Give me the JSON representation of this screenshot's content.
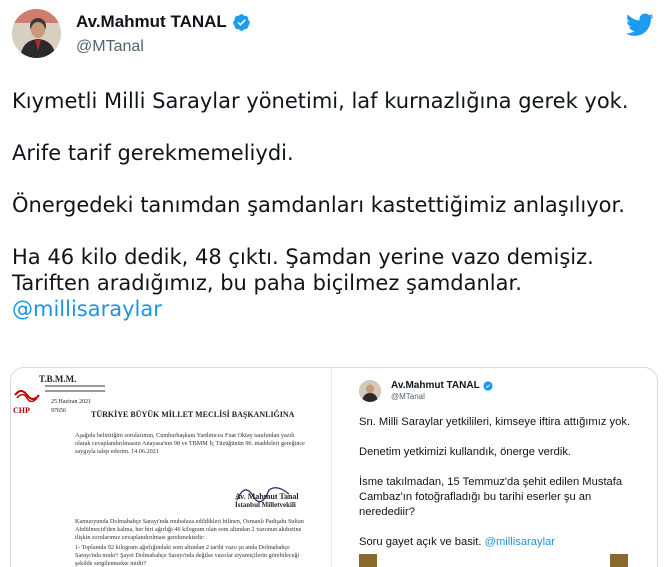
{
  "tweet": {
    "author_name": "Av.Mahmut TANAL",
    "handle": "@MTanal",
    "lines": [
      "Kıymetli Milli Saraylar yönetimi, laf kurnazlığına gerek yok.",
      "Arife tarif gerekmemeliydi.",
      "Önergedeki tanımdan şamdanları kastettiğimiz anlaşılıyor.",
      "Ha 46 kilo dedik, 48 çıktı. Şamdan yerine vazo demişiz.",
      "Tariften aradığımız, bu paha biçilmez şamdanlar.",
      "@millisaraylar"
    ],
    "icons": {
      "verified": "verified-badge-icon",
      "bird": "twitter-bird-icon"
    },
    "colors": {
      "accent": "#1d9bf0",
      "link": "#1b95e0",
      "text": "#0f1419",
      "muted": "#536471"
    }
  },
  "document": {
    "tbmm": "T.B.M.M.",
    "chp": "CHP",
    "date": "25 Haziran 2021",
    "number": "97656",
    "heading": "TÜRKİYE BÜYÜK MİLLET MECLİSİ BAŞKANLIĞINA",
    "para1": "Aşağıda belirttiğim sorularımın, Cumhurbaşkanı Yardımcısı Fuat Oktay tarafından yazılı olarak cevaplandırılmasını Anayasa'nın 98 ve TBMM İç Tüzüğünün 96. maddeleri gereğince saygıyla talep ederim. 14.06.2021",
    "signer_name": "Av. Mahmut Tanal",
    "signer_role": "İstanbul Milletvekili",
    "para2": "Kamuoyunda Dolmabahçe Sarayı'nda muhafaza edildikleri bilinen, Osmanlı Padişahı Sultan Abdülmecid'den kalma, her biri ağırlığı 46 kilogram olan som altından 2 vazonun akıbetine ilişkin sorularımız cevaplandırılması gerekmektedir:",
    "item1": "1- Toplamda 92 kilogram ağırlığındaki som altından 2 tarihi vazo şu anda Dolmabahçe Sarayı'nda mıdır? Şayet Dolmabahçe Sarayı'nda değilse vazolar ziyaretçilerin görebileceği şekilde sergilenmekte midir?"
  },
  "quoted": {
    "author_name": "Av.Mahmut TANAL",
    "handle": "@MTanal",
    "lines": [
      "Sn. Milli Saraylar yetkilileri, kimseye iftira attığımız yok.",
      "Denetim yetkimizi kullandık, önerge verdik.",
      "İsme takılmadan, 15 Temmuz'da şehit edilen Mustafa",
      "Cambaz'ın fotoğrafladığı bu tarihi eserler şu an",
      "neredediir?",
      "Soru gayet açık ve basit.",
      "@millisaraylar"
    ]
  }
}
